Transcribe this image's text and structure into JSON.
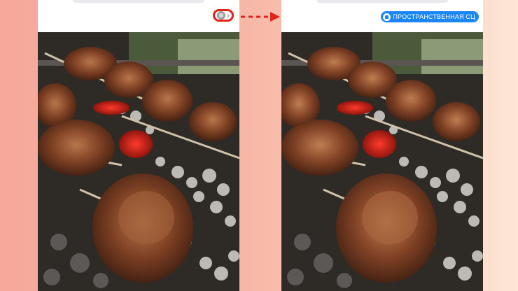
{
  "colors": {
    "background_start": "#f6a89a",
    "background_end": "#fde6d6",
    "highlight_red": "#e2231a",
    "badge_blue": "#1a86f7"
  },
  "left_screen": {
    "toggle_icon": "spatial-photo-icon",
    "chevron_icon": "chevron-right-icon",
    "chevron_glyph": "›"
  },
  "right_screen": {
    "badge_icon": "spatial-photo-icon",
    "badge_label": "ПРОСТРАНСТВЕННАЯ СЦ"
  },
  "photo": {
    "subject": "shashlik-on-grill"
  }
}
